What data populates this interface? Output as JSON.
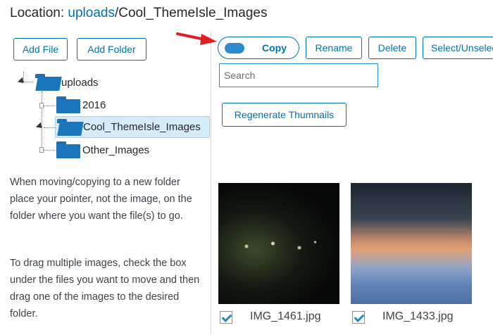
{
  "location": {
    "label": "Location:",
    "root": "uploads",
    "path": "/Cool_ThemeIsle_Images"
  },
  "toolbar_left": {
    "add_file": "Add File",
    "add_folder": "Add Folder"
  },
  "tree": {
    "root": "uploads",
    "children": [
      "2016",
      "Cool_ThemeIsle_Images",
      "Other_Images"
    ],
    "selected": "Cool_ThemeIsle_Images"
  },
  "help": {
    "p1": "When moving/copying to a new folder place your pointer, not the image, on the folder where you want the file(s) to go.",
    "p2": "To drag multiple images, check the box under the files you want to move and then drag one of the images to the desired folder."
  },
  "toolbar_right": {
    "toggle_label": "Copy",
    "rename": "Rename",
    "delete": "Delete",
    "select_unselect": "Select/Unselect"
  },
  "search": {
    "placeholder": "Search"
  },
  "regenerate": "Regenerate Thumnails",
  "files": [
    {
      "name": "IMG_1461.jpg",
      "checked": true
    },
    {
      "name": "IMG_1433.jpg",
      "checked": true
    }
  ],
  "colors": {
    "accent": "#0073aa",
    "folder": "#1b75bb",
    "selected_bg": "#d6ebfa",
    "arrow": "#e02020"
  }
}
